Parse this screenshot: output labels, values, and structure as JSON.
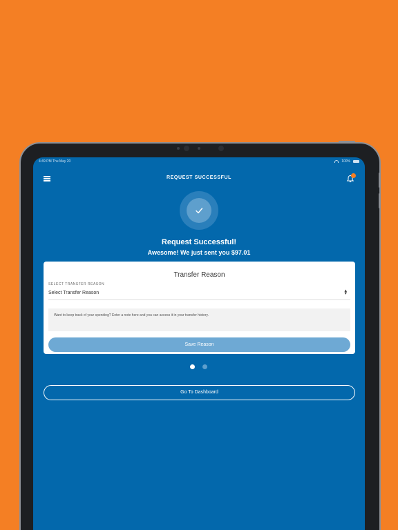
{
  "colors": {
    "background": "#F47F24",
    "screen": "#0368AC",
    "card": "#FFFFFF",
    "save_button": "#6ea9d4",
    "notification_dot": "#F47F24"
  },
  "status_bar": {
    "time": "4:49 PM  Thu May 20",
    "battery": "100%"
  },
  "nav": {
    "title": "REQUEST SUCCESSFUL",
    "menu_icon": "hamburger-icon",
    "notification_icon": "bell-icon"
  },
  "success": {
    "icon": "checkmark-icon",
    "headline": "Request Successful!",
    "message": "Awesome! We just sent you $97.01"
  },
  "card": {
    "title": "Transfer Reason",
    "select_label": "SELECT TRANSFER REASON",
    "select_value": "Select Transfer Reason",
    "note_placeholder": "Want to keep track of your spending? Enter a note here and you can access it in your transfer history.",
    "save_label": "Save Reason"
  },
  "pagination": {
    "total": 2,
    "active": 1
  },
  "dashboard_button": "Go To Dashboard"
}
